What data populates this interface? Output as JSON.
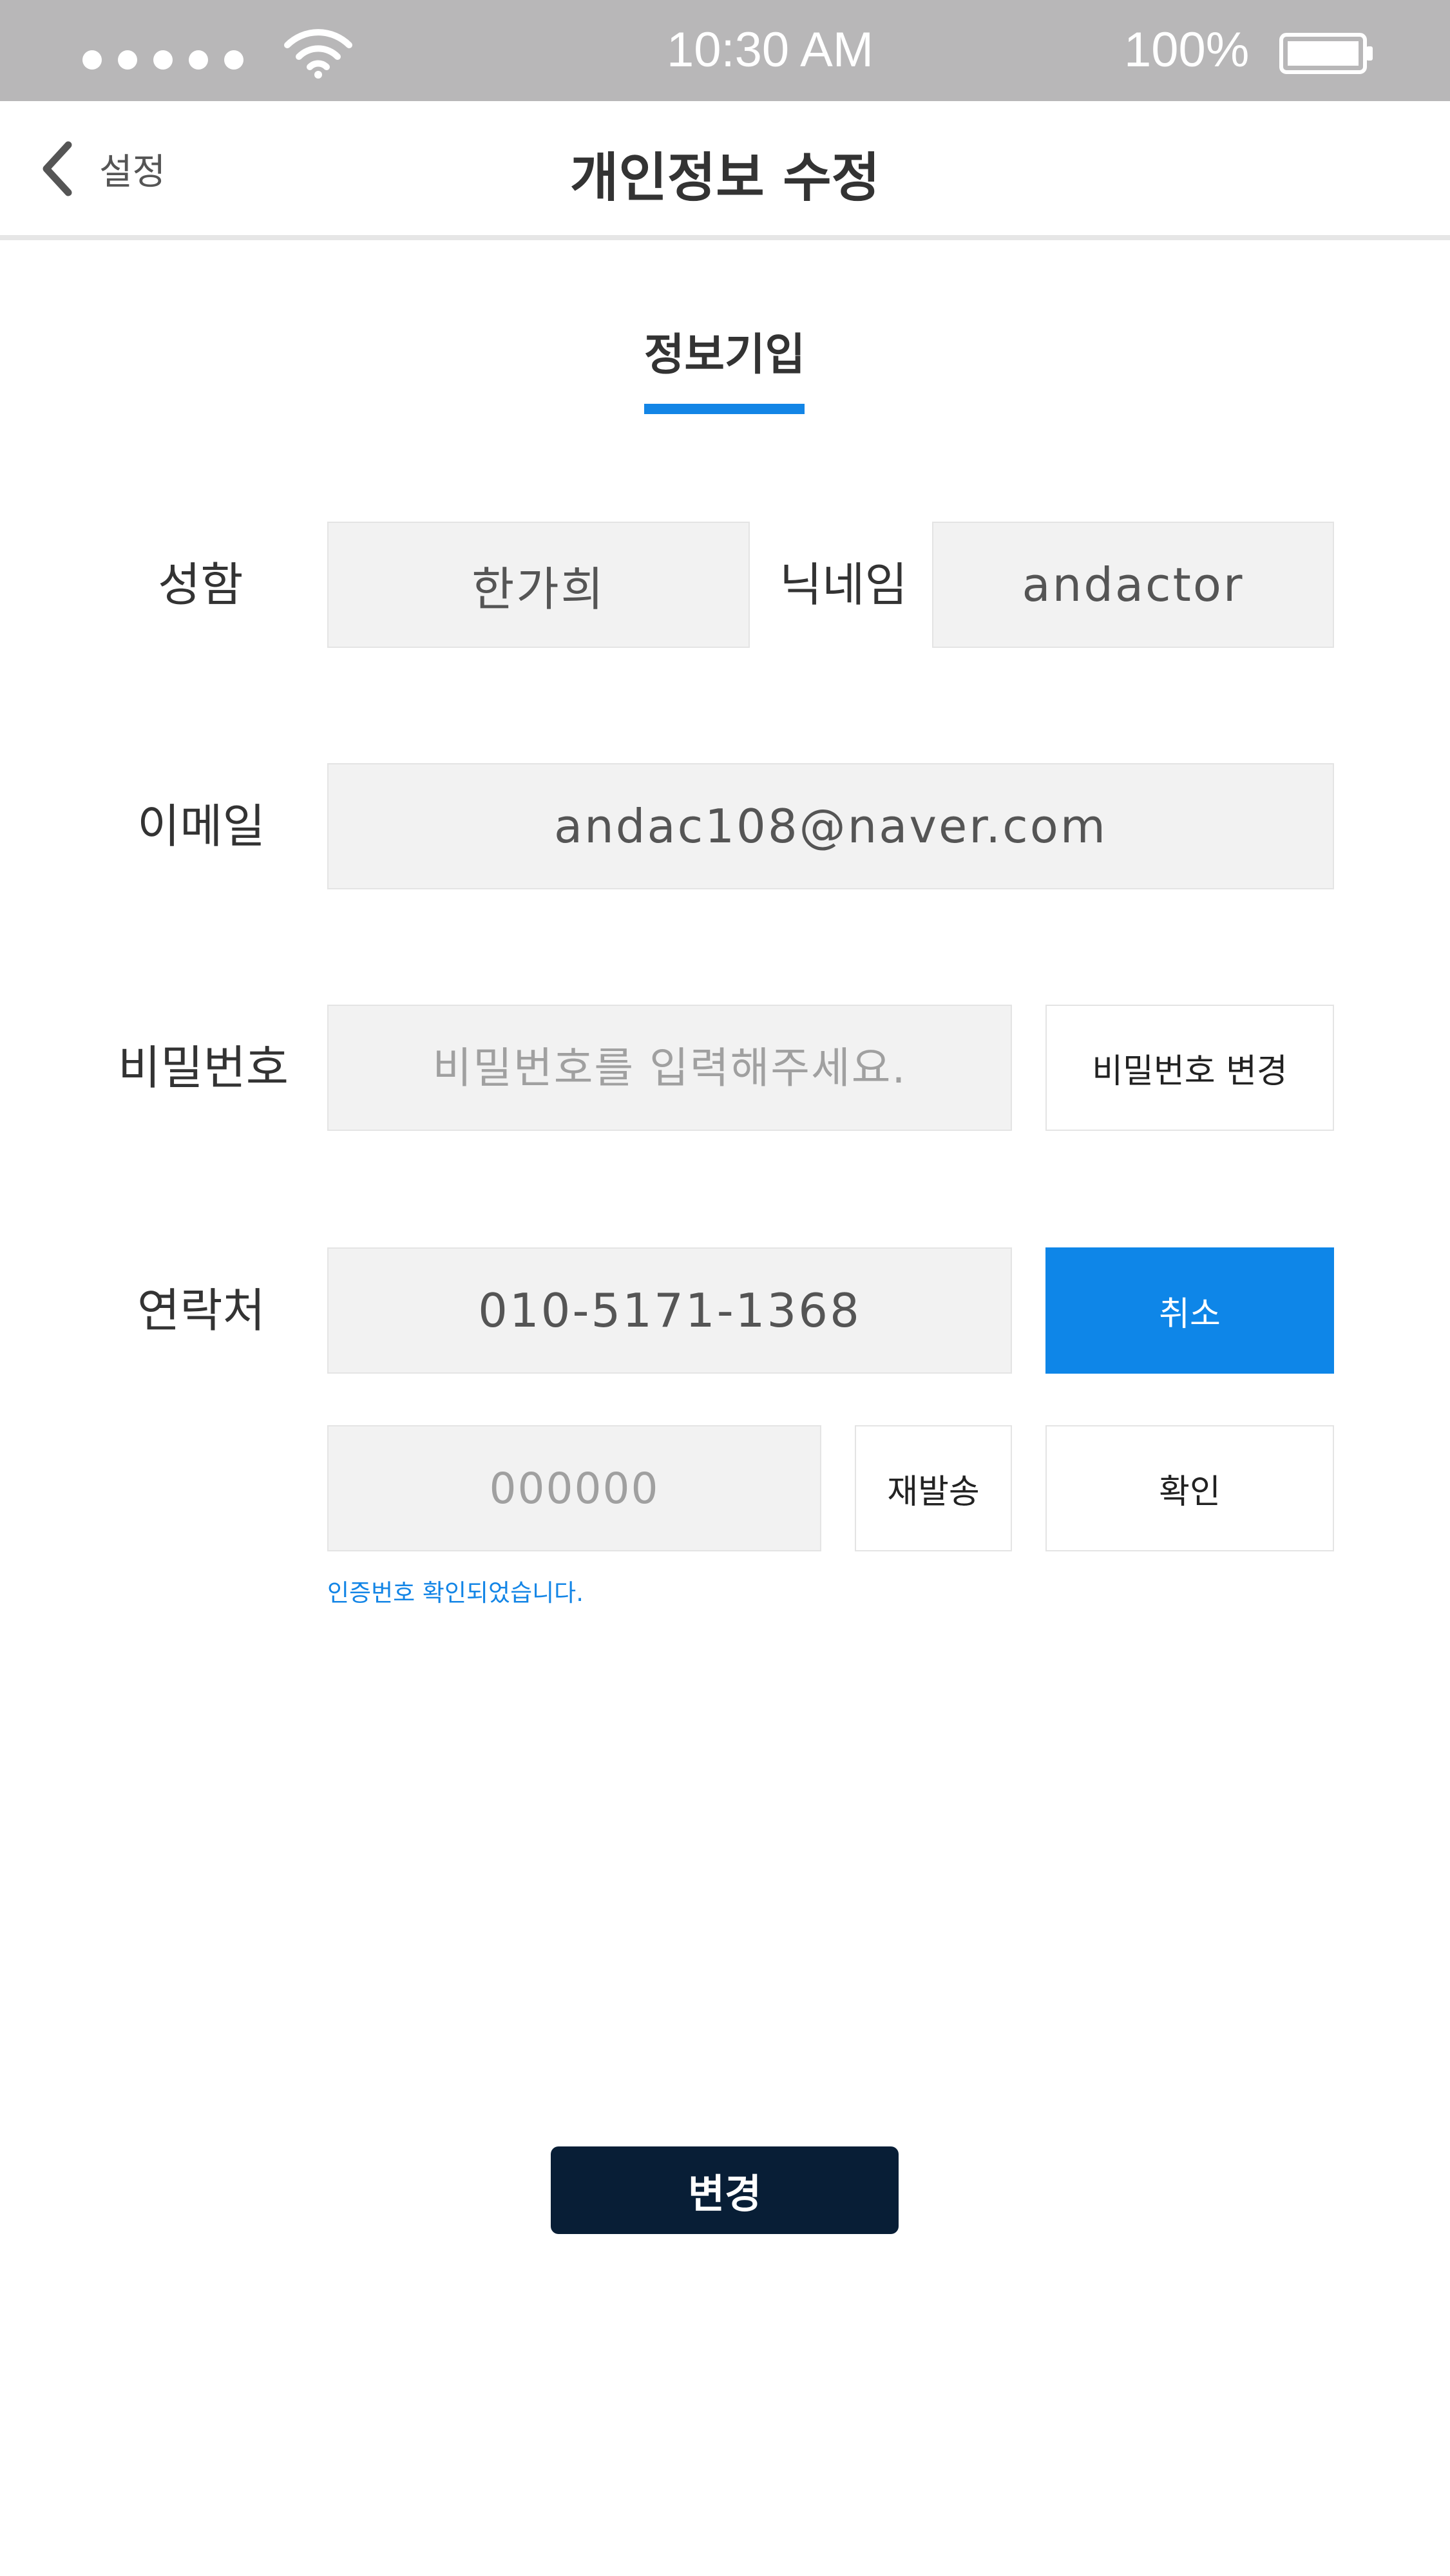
{
  "status_bar": {
    "signal_icon": "signal-dots-icon",
    "wifi_icon": "wifi-icon",
    "time": "10:30 AM",
    "battery_percent": "100%",
    "battery_icon": "battery-icon",
    "battery_level": 1.0
  },
  "nav": {
    "back_icon": "chevron-left-icon",
    "back_label": "설정",
    "title": "개인정보 수정"
  },
  "section": {
    "tab_label": "정보기입",
    "accent_color": "#1385e6"
  },
  "form": {
    "name_label": "성함",
    "name_value": "한가희",
    "nickname_label": "닉네임",
    "nickname_value": "andactor",
    "email_label": "이메일",
    "email_value": "andac108@naver.com",
    "password_label": "비밀번호",
    "password_placeholder": "비밀번호를 입력해주세요.",
    "password_change_button": "비밀번호 변경",
    "contact_label": "연락처",
    "contact_value": "010-5171-1368",
    "cancel_button": "취소",
    "code_placeholder": "000000",
    "resend_button": "재발송",
    "confirm_button": "확인",
    "verify_status": "인증번호 확인되었습니다."
  },
  "submit": {
    "label": "변경",
    "color": "#081e36"
  }
}
